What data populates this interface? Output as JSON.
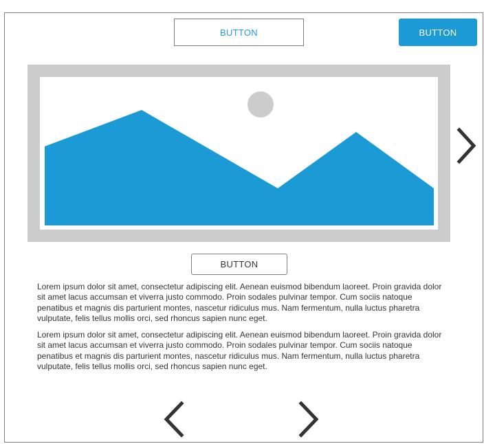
{
  "header": {
    "outline_button_label": "BUTTON",
    "primary_button_label": "BUTTON"
  },
  "carousel": {
    "image_icon": "image-placeholder-icon",
    "next_icon": "chevron-right-icon",
    "caption_button_label": "BUTTON"
  },
  "content": {
    "paragraphs": [
      "Lorem ipsum dolor sit amet, consectetur adipiscing elit. Aenean euismod bibendum laoreet. Proin gravida dolor sit amet lacus accumsan et viverra justo commodo. Proin sodales pulvinar tempor. Cum sociis natoque penatibus et magnis dis parturient montes, nascetur ridiculus mus. Nam fermentum, nulla luctus pharetra vulputate, felis tellus mollis orci, sed rhoncus sapien nunc eget.",
      "Lorem ipsum dolor sit amet, consectetur adipiscing elit. Aenean euismod bibendum laoreet. Proin gravida dolor sit amet lacus accumsan et viverra justo commodo. Proin sodales pulvinar tempor. Cum sociis natoque penatibus et magnis dis parturient montes, nascetur ridiculus mus. Nam fermentum, nulla luctus pharetra vulputate, felis tellus mollis orci, sed rhoncus sapien nunc eget."
    ]
  },
  "pagination": {
    "prev_icon": "chevron-left-icon",
    "next_icon": "chevron-right-icon"
  },
  "colors": {
    "accent": "#1c9ad6",
    "placeholder_frame": "#cccccc",
    "chevron": "#333333"
  }
}
